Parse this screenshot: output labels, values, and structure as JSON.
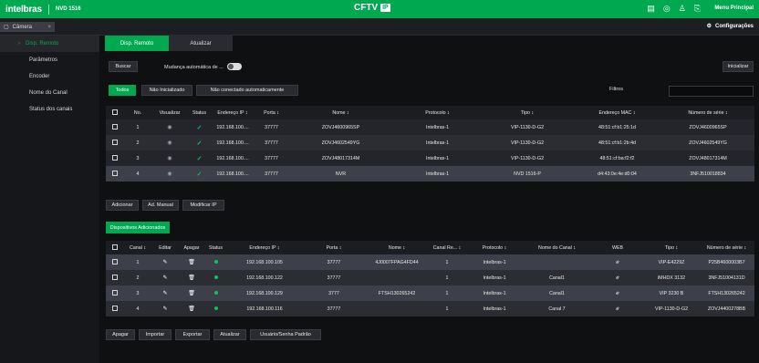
{
  "topbar": {
    "logo": "intelbras",
    "device": "NVD 1516",
    "brand": "CFTV",
    "brand_badge": "IP",
    "menu": "Menu Principal"
  },
  "tabbar": {
    "camera_tab": "Câmera",
    "close": "×",
    "config": "Configurações"
  },
  "sidebar": {
    "items": [
      {
        "label": "Disp. Remoto"
      },
      {
        "label": "Parâmetros"
      },
      {
        "label": "Encoder"
      },
      {
        "label": "Nome do Canal"
      },
      {
        "label": "Status dos canais"
      }
    ]
  },
  "subtabs": [
    "Disp. Remoto",
    "Atualizar"
  ],
  "controls": {
    "search": "Buscar",
    "auto_change": "Mudança automática de ...",
    "init": "Inicializar",
    "all": "Todos",
    "not_init": "Não Inicializado",
    "not_auto": "Não conectado automaticamente",
    "filters": "Filtros"
  },
  "devices_table": {
    "headers": [
      "",
      "No.",
      "Visualizar",
      "Status",
      "Endereço IP ↕",
      "Porta ↕",
      "Nome ↕",
      "Protocolo ↕",
      "Tipo ↕",
      "Endereço MAC ↕",
      "Número de série ↕"
    ],
    "rows": [
      {
        "no": "1",
        "ip": "192.168.100....",
        "port": "37777",
        "name": "ZOVJ4600965SP",
        "protocol": "Intelbras-1",
        "type": "VIP-1130-D-G2",
        "mac": "48:51:cf:b1:25:1d",
        "serial": "ZOVJ4600965SP"
      },
      {
        "no": "2",
        "ip": "192.168.100....",
        "port": "37777",
        "name": "ZOVJ4602549YG",
        "protocol": "Intelbras-1",
        "type": "VIP-1130-D-G2",
        "mac": "48:51:cf:b1:2b:4d",
        "serial": "ZOVJ4602549YG"
      },
      {
        "no": "3",
        "ip": "192.168.100....",
        "port": "37777",
        "name": "ZOVJ48017314M",
        "protocol": "Intelbras-1",
        "type": "VIP-1130-D-G2",
        "mac": "48:51:cf:ba:f2:f2",
        "serial": "ZOVJ48017314M"
      },
      {
        "no": "4",
        "ip": "192.168.100....",
        "port": "37777",
        "name": "NVR",
        "protocol": "Intelbras-1",
        "type": "NVD 1516-P",
        "mac": "d4:43:0e:4e:d0:04",
        "serial": "3NFJ510018834"
      }
    ]
  },
  "mid_buttons": [
    "Adicionar",
    "Ad. Manual",
    "Modificar IP"
  ],
  "added_title": "Dispositivos Adicionados",
  "added_table": {
    "headers": [
      "",
      "Canal ↕",
      "Editar",
      "Apagar",
      "Status",
      "Endereço IP ↕",
      "Porta ↕",
      "Nome ↕",
      "Canal Re... ↕",
      "Protocolo ↕",
      "Nome do Canal ↕",
      "WEB",
      "Tipo ↕",
      "Número de série ↕"
    ],
    "rows": [
      {
        "ch": "1",
        "ip": "192.168.100.105",
        "port": "37777",
        "name": "4J0007FPAG4FD44",
        "chre": "1",
        "protocol": "Intelbras-1",
        "chname": "",
        "type": "VIP-E4229Z",
        "serial": "P25B4600003B7"
      },
      {
        "ch": "2",
        "ip": "192.168.100.122",
        "port": "37777",
        "name": "",
        "chre": "1",
        "protocol": "Intelbras-1",
        "chname": "Canal1",
        "type": "iMHDX 3132",
        "serial": "3NFJ51004131D"
      },
      {
        "ch": "3",
        "ip": "192.168.100.129",
        "port": "3777",
        "name": "FTSH130265242",
        "chre": "1",
        "protocol": "Intelbras-1",
        "chname": "Canal1",
        "type": "VIP 3230 B",
        "serial": "FTSH130265242"
      },
      {
        "ch": "4",
        "ip": "192.168.100.116",
        "port": "37777",
        "name": "",
        "chre": "1",
        "protocol": "Intelbras-1",
        "chname": "Canal 7",
        "type": "VIP-1130-D-G2",
        "serial": "ZOVJ4400278BB"
      }
    ]
  },
  "bottom_buttons": [
    "Apagar",
    "Importar",
    "Exportar",
    "Atualizar",
    "Usuário/Senha Padrão"
  ]
}
